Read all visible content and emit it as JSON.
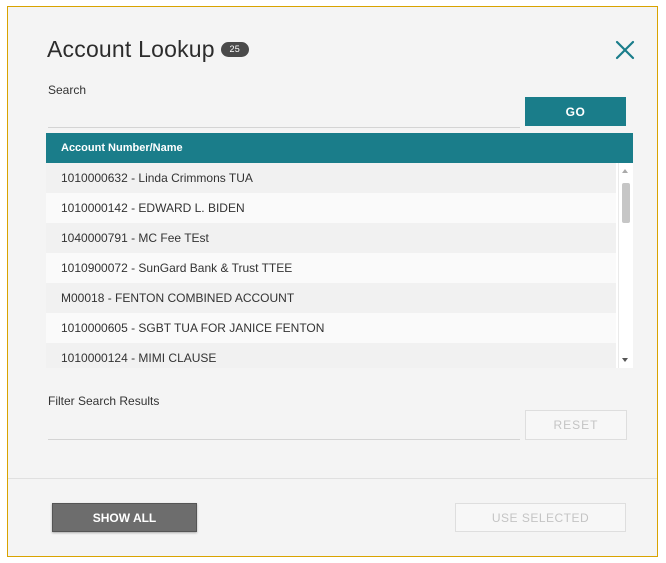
{
  "dialog": {
    "title": "Account Lookup",
    "badge": "25",
    "close_icon": "close-icon"
  },
  "search": {
    "label": "Search",
    "value": "",
    "go_label": "GO"
  },
  "results": {
    "header": "Account Number/Name",
    "rows": [
      "1010000632 - Linda Crimmons TUA",
      "1010000142 - EDWARD L. BIDEN",
      "1040000791 - MC Fee TEst",
      "1010900072 - SunGard Bank & Trust TTEE",
      "M00018 - FENTON COMBINED ACCOUNT",
      "1010000605 - SGBT TUA FOR JANICE FENTON",
      "1010000124 - MIMI CLAUSE"
    ]
  },
  "filter": {
    "label": "Filter Search Results",
    "value": "",
    "reset_label": "RESET"
  },
  "footer": {
    "show_all_label": "SHOW ALL",
    "use_selected_label": "USE SELECTED"
  },
  "colors": {
    "accent": "#1a7d8a",
    "dialog_border": "#d9a300"
  }
}
